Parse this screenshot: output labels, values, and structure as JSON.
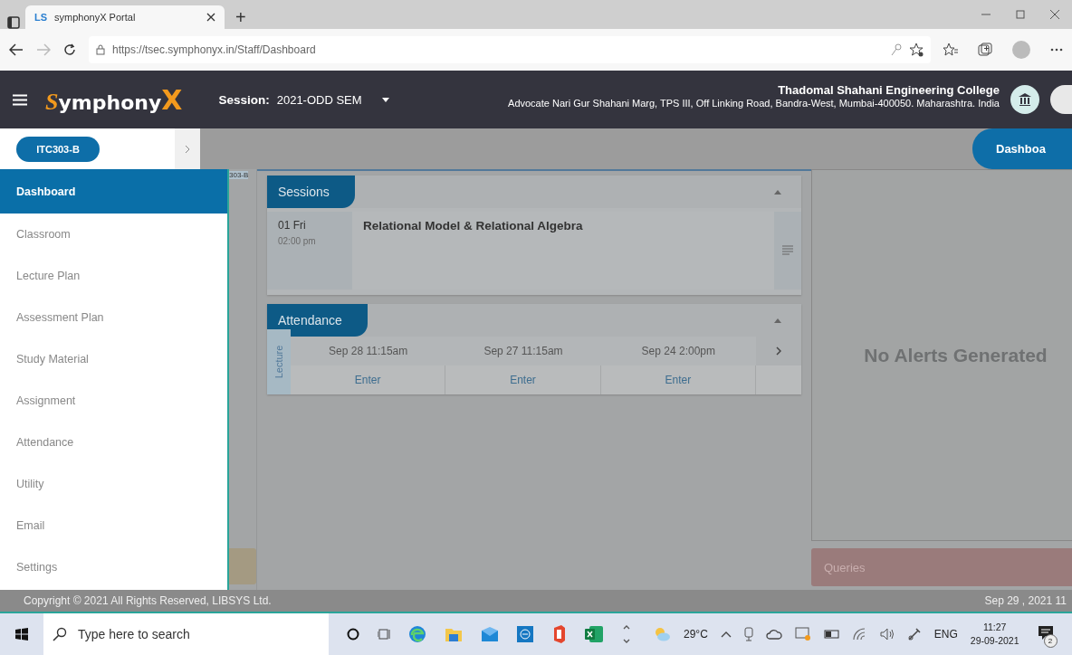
{
  "browser": {
    "tab_favicon": "LS",
    "tab_title": "symphonyX Portal",
    "new_tab": "+",
    "url": "https://tsec.symphonyx.in/Staff/Dashboard"
  },
  "header": {
    "logo_parts": [
      "S",
      "ymphony",
      "X"
    ],
    "session_label": "Session:",
    "session_value": "2021-ODD SEM",
    "college_name": "Thadomal Shahani Engineering College",
    "college_address": "Advocate Nari Gur Shahani Marg, TPS III, Off Linking Road, Bandra-West, Mumbai-400050. Maharashtra. India"
  },
  "subbar": {
    "course_chip": "ITC303-B",
    "page_tab": "Dashboa"
  },
  "sidebar": {
    "items": [
      {
        "label": "Dashboard",
        "selected": true
      },
      {
        "label": "Classroom",
        "selected": false
      },
      {
        "label": "Lecture Plan",
        "selected": false
      },
      {
        "label": "Assessment Plan",
        "selected": false
      },
      {
        "label": "Study Material",
        "selected": false
      },
      {
        "label": "Assignment",
        "selected": false
      },
      {
        "label": "Attendance",
        "selected": false
      },
      {
        "label": "Utility",
        "selected": false
      },
      {
        "label": "Email",
        "selected": false
      },
      {
        "label": "Settings",
        "selected": false
      }
    ]
  },
  "background_strip": {
    "label": "303-B"
  },
  "sessions": {
    "title": "Sessions",
    "entries": [
      {
        "day": "01 Fri",
        "time": "02:00 pm",
        "title": "Relational Model & Relational Algebra"
      }
    ]
  },
  "attendance": {
    "title": "Attendance",
    "row_label": "Lecture",
    "columns": [
      {
        "date": "Sep 28 11:15am",
        "action": "Enter"
      },
      {
        "date": "Sep 27 11:15am",
        "action": "Enter"
      },
      {
        "date": "Sep 24 2:00pm",
        "action": "Enter"
      }
    ]
  },
  "alerts": {
    "message": "No Alerts Generated"
  },
  "queries": {
    "title": "Queries"
  },
  "footer": {
    "copyright": "Copyright © 2021 All Rights Reserved, LIBSYS Ltd.",
    "date": "Sep 29 , 2021 11"
  },
  "taskbar": {
    "search_placeholder": "Type here to search",
    "temperature": "29°C",
    "language": "ENG",
    "time": "11:27",
    "date": "29-09-2021",
    "notifications": "2"
  }
}
